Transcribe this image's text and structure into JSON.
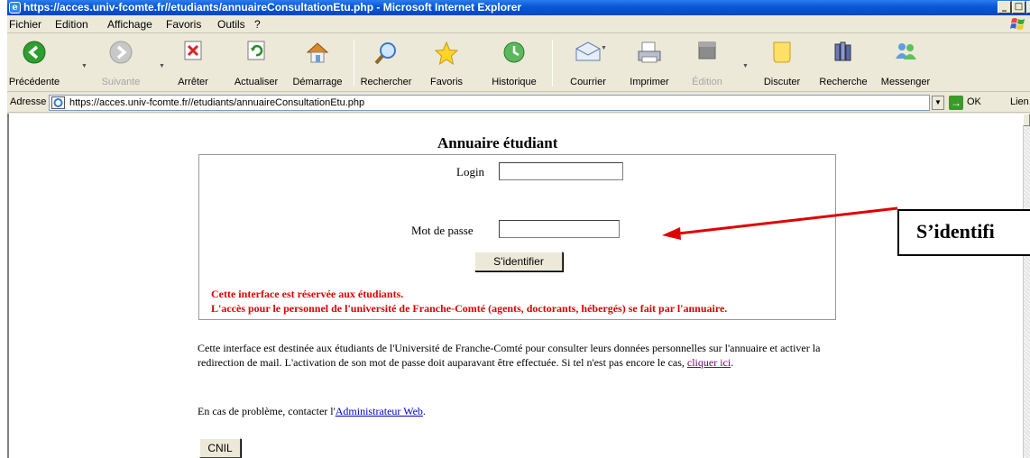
{
  "window": {
    "title": "https://acces.univ-fcomte.fr//etudiants/annuaireConsultationEtu.php - Microsoft Internet Explorer",
    "minimize": "_",
    "restore": "□",
    "close": "×"
  },
  "menu": [
    "Fichier",
    "Edition",
    "Affichage",
    "Favoris",
    "Outils",
    "?"
  ],
  "toolbar": {
    "back": "Précédente",
    "forward": "Suivante",
    "stop": "Arrêter",
    "refresh": "Actualiser",
    "home": "Démarrage",
    "search": "Rechercher",
    "favorites": "Favoris",
    "history": "Historique",
    "mail": "Courrier",
    "print": "Imprimer",
    "edit": "Édition",
    "discuss": "Discuter",
    "research": "Recherche",
    "messenger": "Messenger"
  },
  "address": {
    "label": "Adresse",
    "url": "https://acces.univ-fcomte.fr//etudiants/annuaireConsultationEtu.php",
    "go": "OK",
    "links": "Lien"
  },
  "page": {
    "title": "Annuaire étudiant",
    "login_label": "Login",
    "login_value": "",
    "password_label": "Mot de passe",
    "password_value": "",
    "submit": "S'identifier",
    "warning_1": "Cette interface est réservée aux étudiants.",
    "warning_2": "L'accès pour le personnel de l'université de Franche-Comté (agents, doctorants, hébergés) se fait par l'annuaire.",
    "paragraph": "Cette interface est destinée aux étudiants de l'Université de Franche-Comté pour consulter leurs données personnelles sur l'annuaire et activer la redirection de mail. L'activation de son mot de passe doit auparavant être effectuée. Si tel n'est pas encore le cas,",
    "paragraph_link": "cliquer ici",
    "paragraph_end": ".",
    "contact_prefix": "En cas de problème, contacter l'",
    "contact_link": "Administrateur Web",
    "contact_end": ".",
    "cnil": "CNIL"
  },
  "annotation": {
    "callout": "S’identifi"
  },
  "colors": {
    "warning": "#e00000",
    "link": "#0000cc",
    "visited_link": "#800080",
    "title_bar": "#0a5ad8",
    "arrow": "#e00000"
  }
}
